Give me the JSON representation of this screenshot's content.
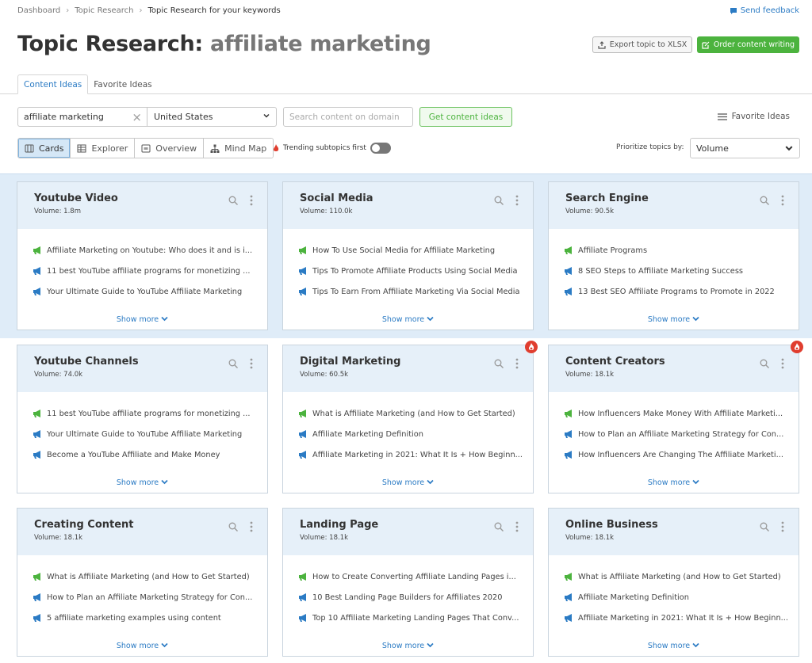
{
  "breadcrumb": [
    "Dashboard",
    "Topic Research",
    "Topic Research for your keywords"
  ],
  "feedback_label": "Send feedback",
  "title": {
    "prefix": "Topic Research:",
    "keyword": "affiliate marketing"
  },
  "actions": {
    "export_label": "Export topic to XLSX",
    "order_label": "Order content writing"
  },
  "tabs": [
    {
      "label": "Content Ideas",
      "active": true
    },
    {
      "label": "Favorite Ideas",
      "active": false
    }
  ],
  "search": {
    "keyword_value": "affiliate marketing",
    "country_value": "United States",
    "domain_placeholder": "Search content on domain",
    "get_ideas_label": "Get content ideas",
    "favorite_link": "Favorite Ideas"
  },
  "views": [
    {
      "label": "Cards",
      "icon": "cards-icon",
      "active": true
    },
    {
      "label": "Explorer",
      "icon": "table-icon",
      "active": false
    },
    {
      "label": "Overview",
      "icon": "overview-icon",
      "active": false
    },
    {
      "label": "Mind Map",
      "icon": "mindmap-icon",
      "active": false
    }
  ],
  "trending": {
    "label": "Trending subtopics first",
    "enabled": false
  },
  "prioritize": {
    "label": "Prioritize topics by:",
    "value": "Volume"
  },
  "colors": {
    "accent_blue": "#2b7bc4",
    "brand_green": "#4cb33e",
    "trending_red": "#e03e2f",
    "card_header": "#e6f0f9"
  },
  "show_more_label": "Show more",
  "cards": [
    {
      "title": "Youtube Video",
      "volume": "Volume: 1.8m",
      "trending": false,
      "items": [
        "Affiliate Marketing on Youtube: Who does it and is i...",
        "11 best YouTube affiliate programs for monetizing ...",
        "Your Ultimate Guide to YouTube Affiliate Marketing"
      ]
    },
    {
      "title": "Social Media",
      "volume": "Volume: 110.0k",
      "trending": false,
      "items": [
        "How To Use Social Media for Affiliate Marketing",
        "Tips To Promote Affiliate Products Using Social Media",
        "Tips To Earn From Affiliate Marketing Via Social Media"
      ]
    },
    {
      "title": "Search Engine",
      "volume": "Volume: 90.5k",
      "trending": false,
      "items": [
        "Affiliate Programs",
        "8 SEO Steps to Affiliate Marketing Success",
        "13 Best SEO Affiliate Programs to Promote in 2022"
      ]
    },
    {
      "title": "Youtube Channels",
      "volume": "Volume: 74.0k",
      "trending": false,
      "items": [
        "11 best YouTube affiliate programs for monetizing ...",
        "Your Ultimate Guide to YouTube Affiliate Marketing",
        "Become a YouTube Affiliate and Make Money"
      ]
    },
    {
      "title": "Digital Marketing",
      "volume": "Volume: 60.5k",
      "trending": true,
      "items": [
        "What is Affiliate Marketing (and How to Get Started)",
        "Affiliate Marketing Definition",
        "Affiliate Marketing in 2021: What It Is + How Beginn..."
      ]
    },
    {
      "title": "Content Creators",
      "volume": "Volume: 18.1k",
      "trending": true,
      "items": [
        "How Influencers Make Money With Affiliate Marketi...",
        "How to Plan an Affiliate Marketing Strategy for Con...",
        "How Influencers Are Changing The Affiliate Marketi..."
      ]
    },
    {
      "title": "Creating Content",
      "volume": "Volume: 18.1k",
      "trending": false,
      "items": [
        "What is Affiliate Marketing (and How to Get Started)",
        "How to Plan an Affiliate Marketing Strategy for Con...",
        "5 affiliate marketing examples using content"
      ]
    },
    {
      "title": "Landing Page",
      "volume": "Volume: 18.1k",
      "trending": false,
      "items": [
        "How to Create Converting Affiliate Landing Pages i...",
        "10 Best Landing Page Builders for Affiliates 2020",
        "Top 10 Affiliate Marketing Landing Pages That Conv..."
      ]
    },
    {
      "title": "Online Business",
      "volume": "Volume: 18.1k",
      "trending": false,
      "items": [
        "What is Affiliate Marketing (and How to Get Started)",
        "Affiliate Marketing Definition",
        "Affiliate Marketing in 2021: What It Is + How Beginn..."
      ]
    }
  ]
}
